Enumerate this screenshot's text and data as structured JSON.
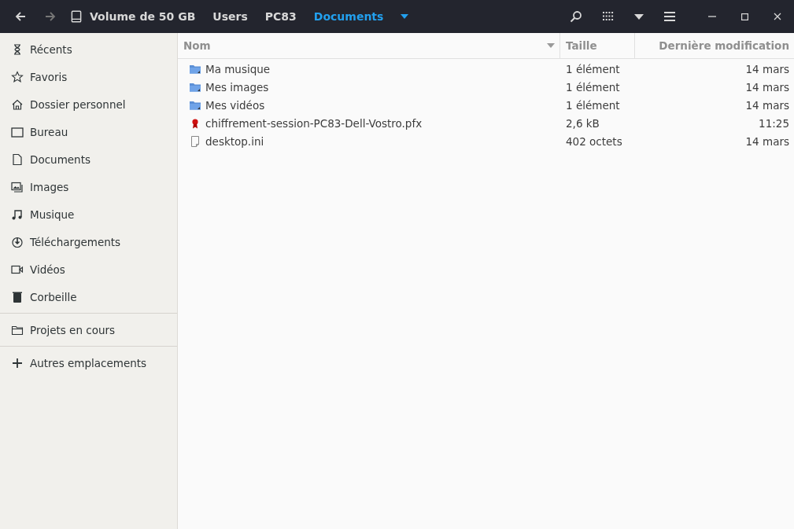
{
  "path_bar": {
    "crumbs": [
      {
        "label": "Volume de 50 GB",
        "kind": "drive",
        "selected": false
      },
      {
        "label": "Users",
        "kind": "plain",
        "selected": false
      },
      {
        "label": "PC83",
        "kind": "plain",
        "selected": false
      },
      {
        "label": "Documents",
        "kind": "plain",
        "selected": true
      }
    ]
  },
  "sidebar": {
    "sections": [
      {
        "items": [
          {
            "label": "Récents",
            "kind": "recent"
          },
          {
            "label": "Favoris",
            "kind": "starred"
          },
          {
            "label": "Dossier personnel",
            "kind": "home"
          },
          {
            "label": "Bureau",
            "kind": "desktop"
          },
          {
            "label": "Documents",
            "kind": "document"
          },
          {
            "label": "Images",
            "kind": "pictures"
          },
          {
            "label": "Musique",
            "kind": "music"
          },
          {
            "label": "Téléchargements",
            "kind": "downloads"
          },
          {
            "label": "Vidéos",
            "kind": "videos"
          },
          {
            "label": "Corbeille",
            "kind": "trash"
          }
        ]
      },
      {
        "items": [
          {
            "label": "Projets en cours",
            "kind": "folder"
          }
        ]
      },
      {
        "items": [
          {
            "label": "Autres emplacements",
            "kind": "add"
          }
        ]
      }
    ]
  },
  "table": {
    "columns": [
      "Nom",
      "Taille",
      "Dernière modification"
    ],
    "rows": [
      {
        "kind": "folder",
        "name": "Ma musique",
        "size": "1 élément",
        "modified": "14 mars"
      },
      {
        "kind": "folder",
        "name": "Mes images",
        "size": "1 élément",
        "modified": "14 mars"
      },
      {
        "kind": "folder",
        "name": "Mes vidéos",
        "size": "1 élément",
        "modified": "14 mars"
      },
      {
        "kind": "certificate",
        "name": "chiffrement-session-PC83-Dell-Vostro.pfx",
        "size": "2,6 kB",
        "modified": "11:25"
      },
      {
        "kind": "file",
        "name": "desktop.ini",
        "size": "402 octets",
        "modified": "14 mars"
      }
    ]
  }
}
